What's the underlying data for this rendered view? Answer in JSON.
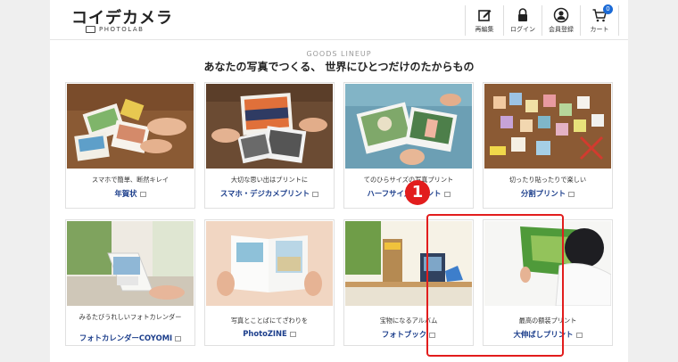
{
  "header": {
    "logo": "コイデカメラ",
    "logo_sub": "PHOTOLAB",
    "nav": [
      {
        "label": "再編集",
        "icon": "edit-icon"
      },
      {
        "label": "ログイン",
        "icon": "lock-icon"
      },
      {
        "label": "会員登録",
        "icon": "user-icon"
      },
      {
        "label": "カート",
        "icon": "cart-icon",
        "badge": "0"
      }
    ]
  },
  "section": {
    "eyebrow": "GOODS LINEUP",
    "tagline": "あなたの写真でつくる、 世界にひとつだけのたからもの"
  },
  "cards": [
    {
      "desc": "スマホで簡単、断然キレイ",
      "title": "年賀状"
    },
    {
      "desc": "大切な思い出はプリントに",
      "title": "スマホ・デジカメプリント"
    },
    {
      "desc": "てのひらサイズの写真プリント",
      "title": "ハーフサイズプリント"
    },
    {
      "desc": "切ったり貼ったりで楽しい",
      "title": "分割プリント"
    },
    {
      "desc": "みるたびうれしいフォトカレンダー",
      "title": "フォトカレンダーCOYOMI"
    },
    {
      "desc": "写真とことばにてざわりを",
      "title": "PhotoZINE"
    },
    {
      "desc": "宝物になるアルバム",
      "title": "フォトブック"
    },
    {
      "desc": "最高の额装プリント",
      "title": "大伸ばしプリント"
    }
  ],
  "annotation": {
    "step": "1"
  },
  "colors": {
    "accent": "#1d3f8c",
    "highlight": "#e21d1d",
    "badge": "#1b6ad6"
  }
}
